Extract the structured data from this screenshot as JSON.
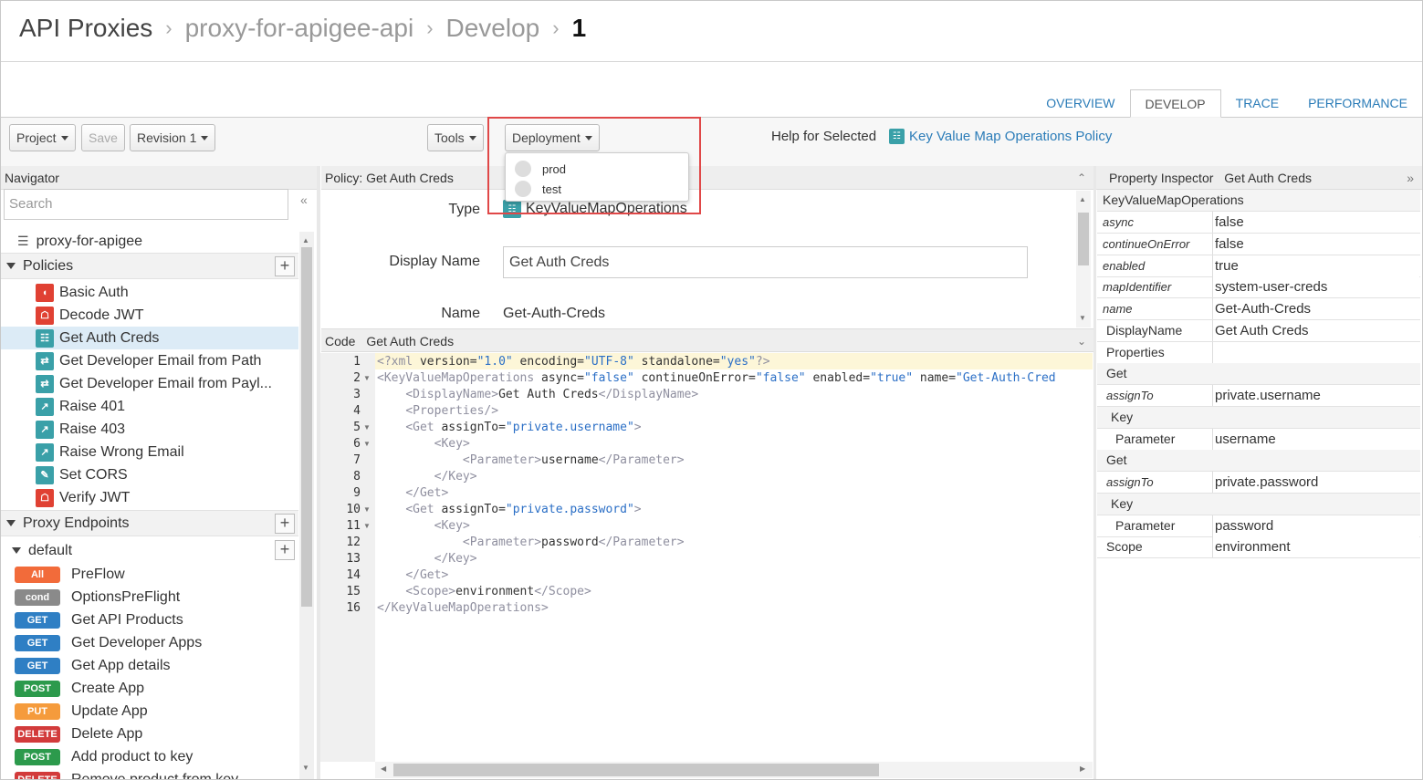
{
  "breadcrumb": {
    "root": "API Proxies",
    "proxy": "proxy-for-apigee-api",
    "section": "Develop",
    "revision": "1"
  },
  "tabs": [
    "OVERVIEW",
    "DEVELOP",
    "TRACE",
    "PERFORMANCE"
  ],
  "toolbar": {
    "project": "Project",
    "save": "Save",
    "revision": "Revision 1",
    "tools": "Tools",
    "deployment": "Deployment",
    "deployment_options": [
      "prod",
      "test"
    ],
    "help_label": "Help for Selected",
    "help_link": "Key Value Map Operations Policy"
  },
  "navigator": {
    "title": "Navigator",
    "search_placeholder": "Search",
    "proxy_name": "proxy-for-apigee",
    "policies_label": "Policies",
    "policies": [
      {
        "name": "Basic Auth",
        "icon": "shield-icon",
        "color": "#e04133"
      },
      {
        "name": "Decode JWT",
        "icon": "lock-icon",
        "color": "#e04133"
      },
      {
        "name": "Get Auth Creds",
        "icon": "key-value-map-icon",
        "color": "#3aa0a8"
      },
      {
        "name": "Get Developer Email from Path",
        "icon": "extract-variables-icon",
        "color": "#3aa0a8"
      },
      {
        "name": "Get Developer Email from Payl...",
        "icon": "extract-variables-icon",
        "color": "#3aa0a8"
      },
      {
        "name": "Raise 401",
        "icon": "raise-fault-icon",
        "color": "#3aa0a8"
      },
      {
        "name": "Raise 403",
        "icon": "raise-fault-icon",
        "color": "#3aa0a8"
      },
      {
        "name": "Raise Wrong Email",
        "icon": "raise-fault-icon",
        "color": "#3aa0a8"
      },
      {
        "name": "Set CORS",
        "icon": "assign-message-icon",
        "color": "#3aa0a8"
      },
      {
        "name": "Verify JWT",
        "icon": "lock-icon",
        "color": "#e04133"
      }
    ],
    "endpoints_label": "Proxy Endpoints",
    "endpoint_name": "default",
    "flows": [
      {
        "badge": "All",
        "color": "#f26b3a",
        "name": "PreFlow"
      },
      {
        "badge": "cond",
        "color": "#8a8a8a",
        "name": "OptionsPreFlight"
      },
      {
        "badge": "GET",
        "color": "#2f7fc4",
        "name": "Get API Products"
      },
      {
        "badge": "GET",
        "color": "#2f7fc4",
        "name": "Get Developer Apps"
      },
      {
        "badge": "GET",
        "color": "#2f7fc4",
        "name": "Get App details"
      },
      {
        "badge": "POST",
        "color": "#2c9a4c",
        "name": "Create App"
      },
      {
        "badge": "PUT",
        "color": "#f59b3c",
        "name": "Update App"
      },
      {
        "badge": "DELETE",
        "color": "#d23b3b",
        "name": "Delete App"
      },
      {
        "badge": "POST",
        "color": "#2c9a4c",
        "name": "Add product to key"
      },
      {
        "badge": "DELETE",
        "color": "#d23b3b",
        "name": "Remove product from key"
      }
    ]
  },
  "policy": {
    "header": "Policy: Get Auth Creds",
    "type_label": "Type",
    "type_value": "KeyValueMapOperations",
    "display_name_label": "Display Name",
    "display_name_value": "Get Auth Creds",
    "name_label": "Name",
    "name_value": "Get-Auth-Creds"
  },
  "code": {
    "header_label": "Code",
    "header_title": "Get Auth Creds",
    "lines": [
      {
        "n": "1",
        "fold": false
      },
      {
        "n": "2",
        "fold": true
      },
      {
        "n": "3",
        "fold": false
      },
      {
        "n": "4",
        "fold": false
      },
      {
        "n": "5",
        "fold": true
      },
      {
        "n": "6",
        "fold": true
      },
      {
        "n": "7",
        "fold": false
      },
      {
        "n": "8",
        "fold": false
      },
      {
        "n": "9",
        "fold": false
      },
      {
        "n": "10",
        "fold": true
      },
      {
        "n": "11",
        "fold": true
      },
      {
        "n": "12",
        "fold": false
      },
      {
        "n": "13",
        "fold": false
      },
      {
        "n": "14",
        "fold": false
      },
      {
        "n": "15",
        "fold": false
      },
      {
        "n": "16",
        "fold": false
      }
    ],
    "text": [
      "<?xml version=\"1.0\" encoding=\"UTF-8\" standalone=\"yes\"?>",
      "<KeyValueMapOperations async=\"false\" continueOnError=\"false\" enabled=\"true\" name=\"Get-Auth-Cred",
      "    <DisplayName>Get Auth Creds</DisplayName>",
      "    <Properties/>",
      "    <Get assignTo=\"private.username\">",
      "        <Key>",
      "            <Parameter>username</Parameter>",
      "        </Key>",
      "    </Get>",
      "    <Get assignTo=\"private.password\">",
      "        <Key>",
      "            <Parameter>password</Parameter>",
      "        </Key>",
      "    </Get>",
      "    <Scope>environment</Scope>",
      "</KeyValueMapOperations>"
    ]
  },
  "inspector": {
    "title": "Property Inspector",
    "subject": "Get Auth Creds",
    "root": "KeyValueMapOperations",
    "rows": [
      {
        "key": "async",
        "val": "false",
        "italic": true,
        "indent": 6,
        "grp": false
      },
      {
        "key": "continueOnError",
        "val": "false",
        "italic": true,
        "indent": 6,
        "grp": false
      },
      {
        "key": "enabled",
        "val": "true",
        "italic": true,
        "indent": 6,
        "grp": false
      },
      {
        "key": "mapIdentifier",
        "val": "system-user-creds",
        "italic": true,
        "indent": 6,
        "grp": false
      },
      {
        "key": "name",
        "val": "Get-Auth-Creds",
        "italic": true,
        "indent": 6,
        "grp": false
      },
      {
        "key": "DisplayName",
        "val": "Get Auth Creds",
        "italic": false,
        "indent": 10,
        "grp": false
      },
      {
        "key": "Properties",
        "val": "",
        "italic": false,
        "indent": 10,
        "grp": false
      },
      {
        "key": "Get",
        "val": null,
        "italic": false,
        "indent": 10,
        "grp": true
      },
      {
        "key": "assignTo",
        "val": "private.username",
        "italic": true,
        "indent": 10,
        "grp": false
      },
      {
        "key": "Key",
        "val": null,
        "italic": false,
        "indent": 15,
        "grp": true
      },
      {
        "key": "Parameter",
        "val": "username",
        "italic": false,
        "indent": 20,
        "grp": false
      },
      {
        "key": "Get",
        "val": null,
        "italic": false,
        "indent": 10,
        "grp": true
      },
      {
        "key": "assignTo",
        "val": "private.password",
        "italic": true,
        "indent": 10,
        "grp": false
      },
      {
        "key": "Key",
        "val": null,
        "italic": false,
        "indent": 15,
        "grp": true
      },
      {
        "key": "Parameter",
        "val": "password",
        "italic": false,
        "indent": 20,
        "grp": false
      },
      {
        "key": "Scope",
        "val": "environment",
        "italic": false,
        "indent": 10,
        "grp": false
      }
    ]
  }
}
